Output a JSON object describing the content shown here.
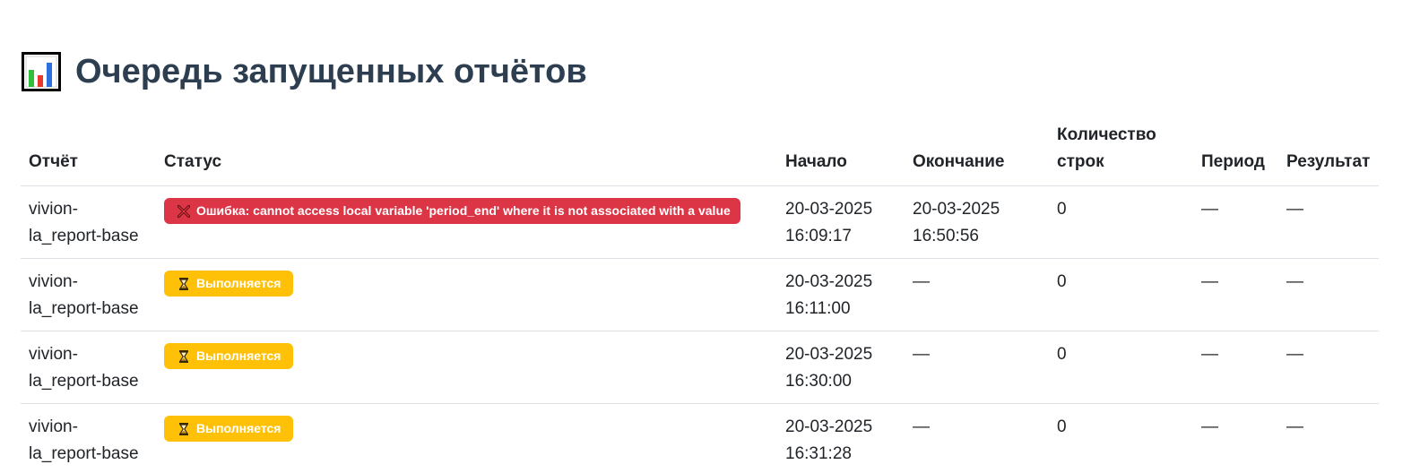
{
  "page": {
    "title": "Очередь запущенных отчётов",
    "title_icon": "bar-chart-icon"
  },
  "table": {
    "headers": {
      "report": "Отчёт",
      "status": "Статус",
      "start": "Начало",
      "end": "Окончание",
      "rows_count": "Количество строк",
      "period": "Период",
      "result": "Результат"
    },
    "rows": [
      {
        "report": "vivion-la_report-base",
        "status_type": "error",
        "status_icon": "cross-icon",
        "status": "Ошибка: cannot access local variable 'period_end' where it is not associated with a value",
        "start_date": "20-03-2025",
        "start_time": "16:09:17",
        "end_date": "20-03-2025",
        "end_time": "16:50:56",
        "rows_count": "0",
        "period": "—",
        "result": "—"
      },
      {
        "report": "vivion-la_report-base",
        "status_type": "running",
        "status_icon": "hourglass-icon",
        "status": "Выполняется",
        "start_date": "20-03-2025",
        "start_time": "16:11:00",
        "end_date": "—",
        "end_time": "",
        "rows_count": "0",
        "period": "—",
        "result": "—"
      },
      {
        "report": "vivion-la_report-base",
        "status_type": "running",
        "status_icon": "hourglass-icon",
        "status": "Выполняется",
        "start_date": "20-03-2025",
        "start_time": "16:30:00",
        "end_date": "—",
        "end_time": "",
        "rows_count": "0",
        "period": "—",
        "result": "—"
      },
      {
        "report": "vivion-la_report-base",
        "status_type": "running",
        "status_icon": "hourglass-icon",
        "status": "Выполняется",
        "start_date": "20-03-2025",
        "start_time": "16:31:28",
        "end_date": "—",
        "end_time": "",
        "rows_count": "0",
        "period": "—",
        "result": "—"
      }
    ]
  },
  "colors": {
    "title": "#2c3e50",
    "error_badge": "#dc3545",
    "running_badge": "#ffc107",
    "border": "#dee2e6"
  }
}
